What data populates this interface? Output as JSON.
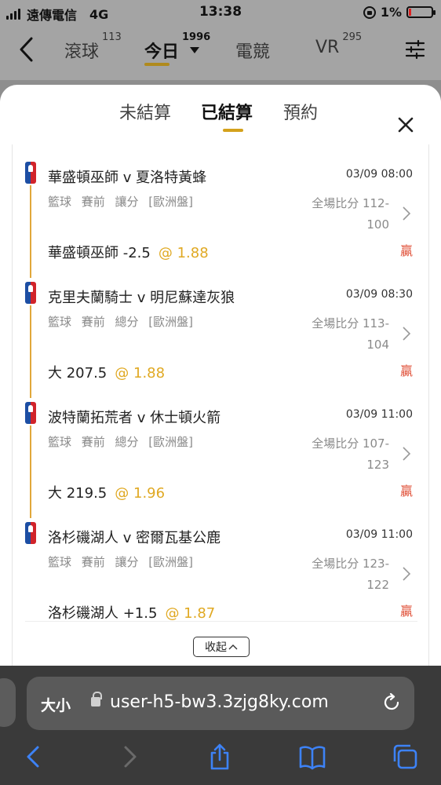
{
  "status": {
    "carrier": "遠傳電信",
    "network": "4G",
    "time": "13:38",
    "battery": "1%",
    "battery_level": 0.01
  },
  "nav": {
    "items": [
      {
        "label": "滾球",
        "count": "113"
      },
      {
        "label": "今日",
        "count": "1996"
      },
      {
        "label": "電競",
        "count": ""
      },
      {
        "label": "VR",
        "count": "295"
      }
    ]
  },
  "sheet": {
    "tabs": [
      "未結算",
      "已結算",
      "預約"
    ],
    "active_tab": "已結算"
  },
  "matches": [
    {
      "teams": "華盛頓巫師 v 夏洛特黃蜂",
      "date": "03/09 08:00",
      "meta": "籃球 賽前 讓分 [歐洲盤]",
      "score_label": "全場比分 112-",
      "score_tail": "100",
      "bet": "華盛頓巫師 -2.5",
      "odds": "@ 1.88",
      "result": "贏"
    },
    {
      "teams": "克里夫蘭騎士 v 明尼蘇達灰狼",
      "date": "03/09 08:30",
      "meta": "籃球 賽前 總分 [歐洲盤]",
      "score_label": "全場比分 113-",
      "score_tail": "104",
      "bet": "大 207.5",
      "odds": "@ 1.88",
      "result": "贏"
    },
    {
      "teams": "波特蘭拓荒者 v 休士頓火箭",
      "date": "03/09 11:00",
      "meta": "籃球 賽前 總分 [歐洲盤]",
      "score_label": "全場比分 107-",
      "score_tail": "123",
      "bet": "大 219.5",
      "odds": "@ 1.96",
      "result": "贏"
    },
    {
      "teams": "洛杉磯湖人 v 密爾瓦基公鹿",
      "date": "03/09 11:00",
      "meta": "籃球 賽前 讓分 [歐洲盤]",
      "score_label": "全場比分 123-",
      "score_tail": "122",
      "bet": "洛杉磯湖人 +1.5",
      "odds": "@ 1.87",
      "result": "贏"
    }
  ],
  "collapse_label": "收起",
  "browser": {
    "text_size_label": "大小",
    "url": "user-h5-bw3.3zjg8ky.com"
  },
  "colors": {
    "accent": "#d4a11c",
    "win": "#e0523a",
    "odds": "#e0a923"
  }
}
